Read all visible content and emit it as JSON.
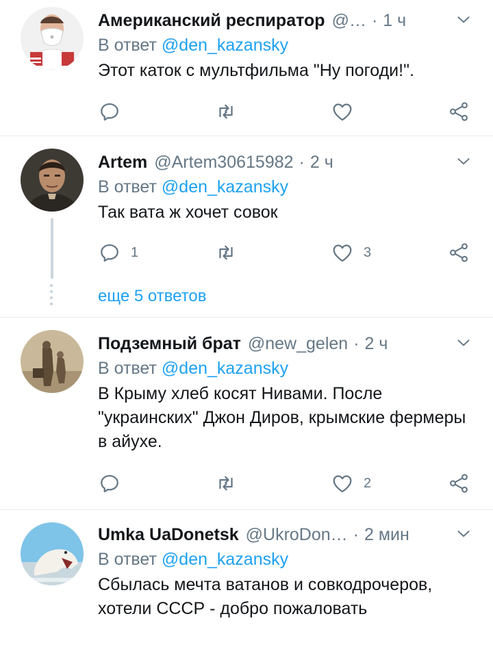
{
  "tweets": [
    {
      "name": "Американский респиратор",
      "handle": "@…",
      "time": "1 ч",
      "reply_prefix": "В ответ",
      "reply_to": "@den_kazansky",
      "text": "Этот каток с мультфильма \"Ну погоди!\".",
      "replies": "",
      "likes": "",
      "avatar_icon": "respirator-man-avatar"
    },
    {
      "name": "Artem",
      "handle": "@Artem30615982",
      "time": "2 ч",
      "reply_prefix": "В ответ",
      "reply_to": "@den_kazansky",
      "text": "Так вата ж хочет совок",
      "replies": "1",
      "likes": "3",
      "avatar_icon": "man-portrait-avatar"
    },
    {
      "name": "Подземный брат",
      "handle": "@new_gelen",
      "time": "2 ч",
      "reply_prefix": "В ответ",
      "reply_to": "@den_kazansky",
      "text": "В Крыму хлеб косят Нивами. После \"украинских\" Джон Диров, крымские фермеры в айухе.",
      "replies": "",
      "likes": "2",
      "avatar_icon": "sepia-photo-avatar"
    },
    {
      "name": "Umka UaDonetsk",
      "handle": "@UkroDon…",
      "time": "2 мин",
      "reply_prefix": "В ответ",
      "reply_to": "@den_kazansky",
      "text": "Сбылась мечта ватанов и совкодрочеров, хотели  СССР - добро пожаловать",
      "avatar_icon": "polar-bear-avatar"
    }
  ],
  "thread": {
    "more_replies": "еще 5 ответов"
  },
  "colors": {
    "accent": "#1da1f2",
    "muted": "#657786",
    "divider": "#e6ecf0"
  }
}
